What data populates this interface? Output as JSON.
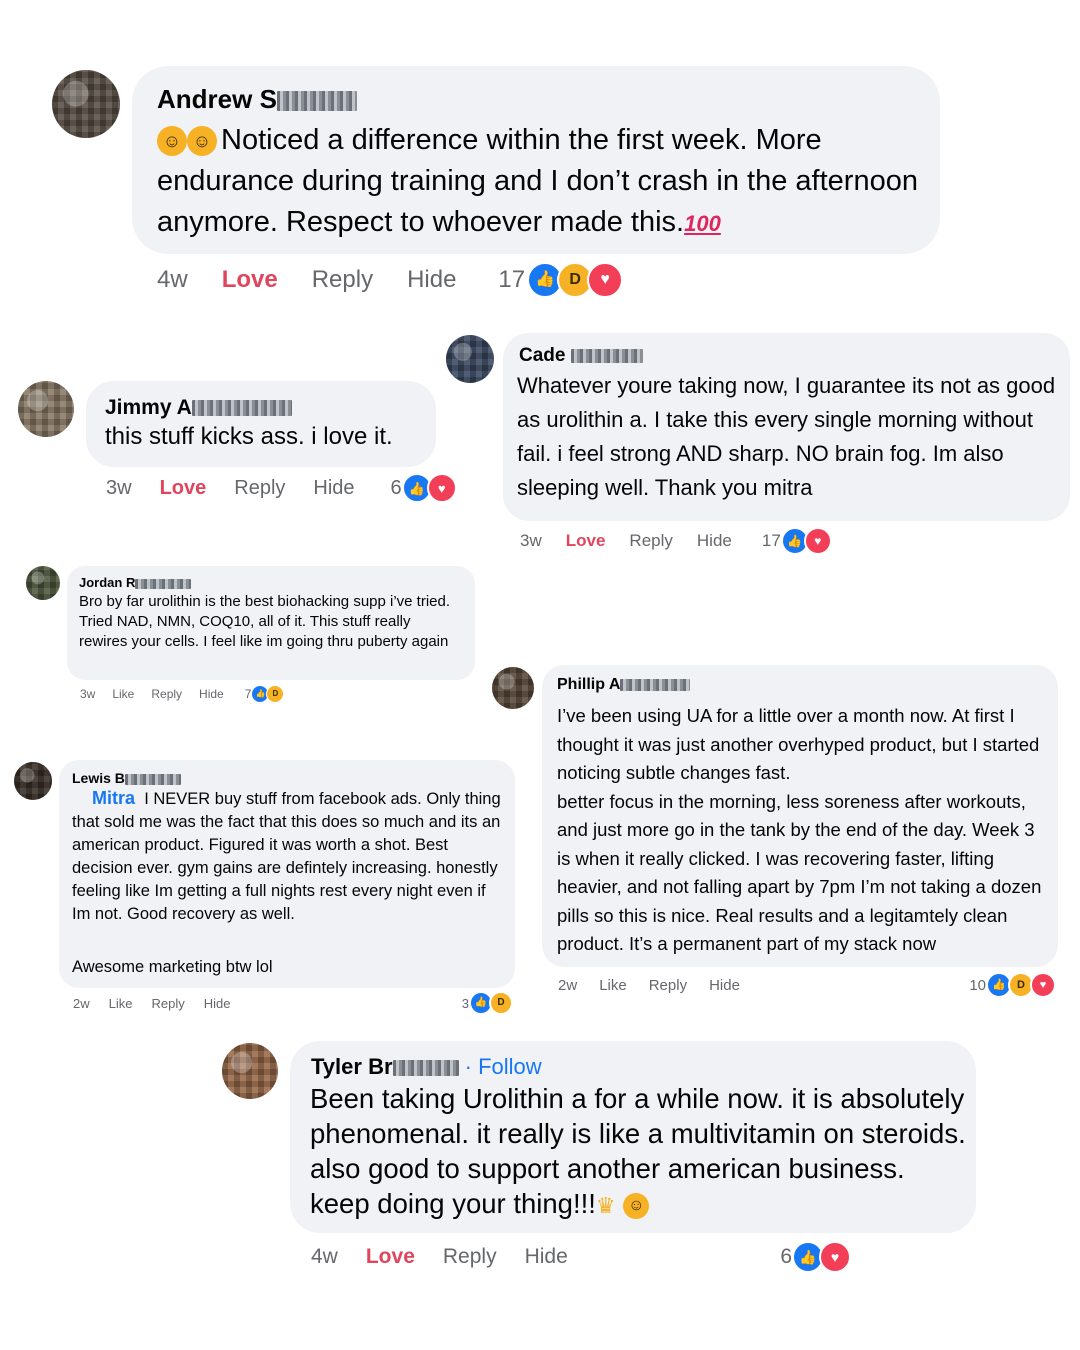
{
  "comments": [
    {
      "id": "andrew",
      "name_visible": "Andrew S",
      "text": "Noticed a difference within the first week. More endurance during training and I don’t crash in the afternoon anymore. Respect to whoever made this.",
      "suffix": "100",
      "time": "4w",
      "react_label": "Love",
      "reply": "Reply",
      "hide": "Hide",
      "count": "17",
      "reactions": [
        "like-icon",
        "haha-icon",
        "heart-icon"
      ]
    },
    {
      "id": "jimmy",
      "name_visible": "Jimmy A",
      "text": "this stuff kicks ass. i love it.",
      "time": "3w",
      "react_label": "Love",
      "reply": "Reply",
      "hide": "Hide",
      "count": "6",
      "reactions": [
        "like-icon",
        "heart-icon"
      ]
    },
    {
      "id": "cade",
      "name_visible": "Cade",
      "text": "Whatever youre taking now, I guarantee its not as good as urolithin a. I take this every single morning without fail. i feel strong AND sharp. NO brain fog. Im also sleeping well. Thank you mitra",
      "time": "3w",
      "react_label": "Love",
      "reply": "Reply",
      "hide": "Hide",
      "count": "17",
      "reactions": [
        "like-icon",
        "heart-icon"
      ]
    },
    {
      "id": "jordan",
      "name_visible": "Jordan R",
      "text": "Bro by far urolithin is the best biohacking supp i’ve tried. Tried NAD, NMN, COQ10, all of it. This stuff really rewires your cells. I feel like im going thru puberty again",
      "time": "3w",
      "react_label": "Like",
      "reply": "Reply",
      "hide": "Hide",
      "count": "7",
      "reactions": [
        "like-icon",
        "haha-icon"
      ]
    },
    {
      "id": "phillip",
      "name_visible": "Phillip A",
      "text": "I’ve been using UA for a little over a month now. At first I thought it was just another overhyped product, but I started noticing subtle changes fast.\nbetter focus in the morning, less soreness after workouts, and just more go in the tank by the end of the day. Week 3 is when it really clicked. I was recovering faster, lifting heavier, and not falling apart by 7pm I’m not taking a dozen pills so this is nice. Real results and a legitamtely clean product. It’s a permanent part of my stack now",
      "time": "2w",
      "react_label": "Like",
      "reply": "Reply",
      "hide": "Hide",
      "count": "10",
      "reactions": [
        "like-icon",
        "haha-icon",
        "heart-icon"
      ]
    },
    {
      "id": "lewis",
      "name_visible": "Lewis B",
      "mention": "Mitra",
      "text": "I NEVER buy stuff from facebook ads. Only thing that sold me was the fact that this does so much and its an american product. Figured it was worth a shot. Best decision ever. gym gains are defintely increasing. honestly feeling like Im getting a full nights rest every night even if Im not. Good recovery as well.",
      "text2": "Awesome marketing btw lol",
      "time": "2w",
      "react_label": "Like",
      "reply": "Reply",
      "hide": "Hide",
      "count": "3",
      "reactions": [
        "like-icon",
        "haha-icon"
      ]
    },
    {
      "id": "tyler",
      "name_visible": "Tyler Br",
      "follow": "· Follow",
      "text": "Been taking Urolithin a for a while now. it is absolutely phenomenal. it really is like a multivitamin on steroids. also good to support another american business. keep doing your thing!!!",
      "time": "4w",
      "react_label": "Love",
      "reply": "Reply",
      "hide": "Hide",
      "count": "6",
      "reactions": [
        "like-icon",
        "heart-icon"
      ]
    }
  ],
  "colors": {
    "bubble": "#f0f2f5",
    "love": "#e0455d",
    "link": "#1877f2",
    "meta": "#65676b",
    "like": "#1877f2",
    "heart": "#f33e58",
    "haha": "#f7b125"
  }
}
